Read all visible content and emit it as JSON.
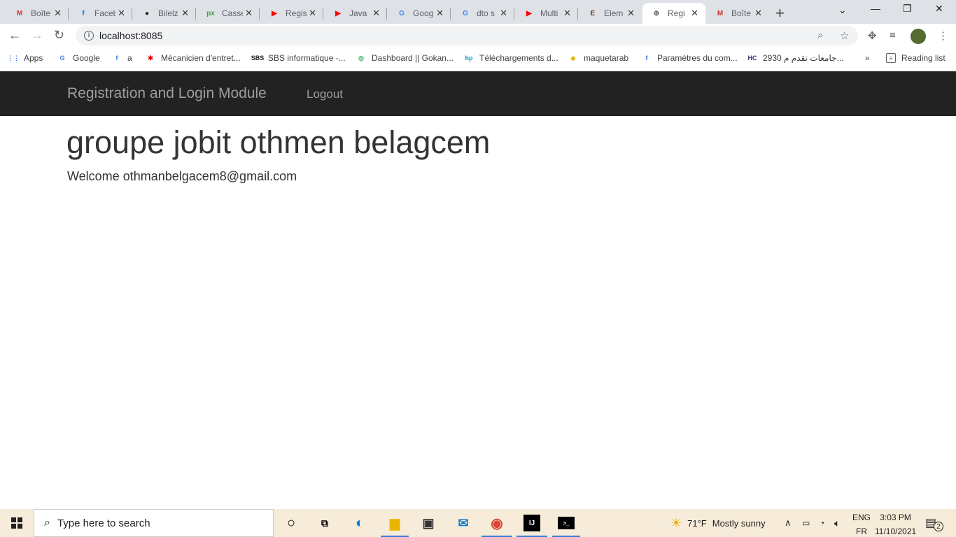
{
  "browser": {
    "tabs": [
      {
        "title": "Boîte",
        "icon": "gmail-icon",
        "color": "#d93025",
        "glyph": "M",
        "active": false
      },
      {
        "title": "Faceb",
        "icon": "facebook-icon",
        "color": "#1877f2",
        "glyph": "f",
        "active": false
      },
      {
        "title": "Bilelz",
        "icon": "github-icon",
        "color": "#202124",
        "glyph": "●",
        "active": false
      },
      {
        "title": "Casse",
        "icon": "px-icon",
        "color": "#3fa33a",
        "glyph": "px",
        "active": false
      },
      {
        "title": "Regis",
        "icon": "youtube-icon",
        "color": "#ff0000",
        "glyph": "▶",
        "active": false
      },
      {
        "title": "Java",
        "icon": "youtube-icon",
        "color": "#ff0000",
        "glyph": "▶",
        "active": false
      },
      {
        "title": "Goog",
        "icon": "google-translate-icon",
        "color": "#4285f4",
        "glyph": "G",
        "active": false
      },
      {
        "title": "dto s",
        "icon": "google-icon",
        "color": "#4285f4",
        "glyph": "G",
        "active": false
      },
      {
        "title": "Multi",
        "icon": "youtube-icon",
        "color": "#ff0000",
        "glyph": "▶",
        "active": false
      },
      {
        "title": "Elem",
        "icon": "element-icon",
        "color": "#5a3b1e",
        "glyph": "E",
        "active": false
      },
      {
        "title": "Regi",
        "icon": "globe-icon",
        "color": "#5f6368",
        "glyph": "⊕",
        "active": true
      },
      {
        "title": "Boîte",
        "icon": "gmail-icon",
        "color": "#d93025",
        "glyph": "M",
        "active": false
      }
    ],
    "close_glyph": "✕",
    "new_tab": "+",
    "url": "localhost:8085",
    "bookmarks": [
      {
        "label": "Apps",
        "icon": "apps-grid-icon",
        "color": "#4285f4",
        "glyph": "⋮⋮"
      },
      {
        "label": "Google",
        "icon": "google-icon",
        "color": "#4285f4",
        "glyph": "G"
      },
      {
        "label": "a",
        "icon": "facebook-icon",
        "color": "#1877f2",
        "glyph": "f"
      },
      {
        "label": "Mécanicien d'entret...",
        "icon": "star-burst-icon",
        "color": "#e60000",
        "glyph": "✱"
      },
      {
        "label": "SBS informatique -...",
        "icon": "sbs-icon",
        "color": "#202124",
        "glyph": "SBS"
      },
      {
        "label": "Dashboard || Gokan...",
        "icon": "dashboard-icon",
        "color": "#34a853",
        "glyph": "◎"
      },
      {
        "label": "Téléchargements d...",
        "icon": "hp-icon",
        "color": "#0096d6",
        "glyph": "hp"
      },
      {
        "label": "maquetarab",
        "icon": "maquetarab-icon",
        "color": "#e8b400",
        "glyph": "◆"
      },
      {
        "label": "Paramètres du com...",
        "icon": "facebook-icon",
        "color": "#1877f2",
        "glyph": "f"
      },
      {
        "label": "2930 جامعات تقدم م...",
        "icon": "hc-icon",
        "color": "#3b2f7a",
        "glyph": "HC"
      }
    ],
    "more_bookmarks": "»",
    "reading_list": "Reading list"
  },
  "page": {
    "brand": "Registration and Login Module",
    "logout": "Logout",
    "heading": "groupe jobit othmen belagcem",
    "welcome": "Welcome othmanbelgacem8@gmail.com"
  },
  "taskbar": {
    "search_placeholder": "Type here to search",
    "weather_temp": "71°F",
    "weather_desc": "Mostly sunny",
    "lang_top": "ENG",
    "lang_bottom": "FR",
    "time": "3:03 PM",
    "date": "11/10/2021",
    "notification_count": "2"
  }
}
